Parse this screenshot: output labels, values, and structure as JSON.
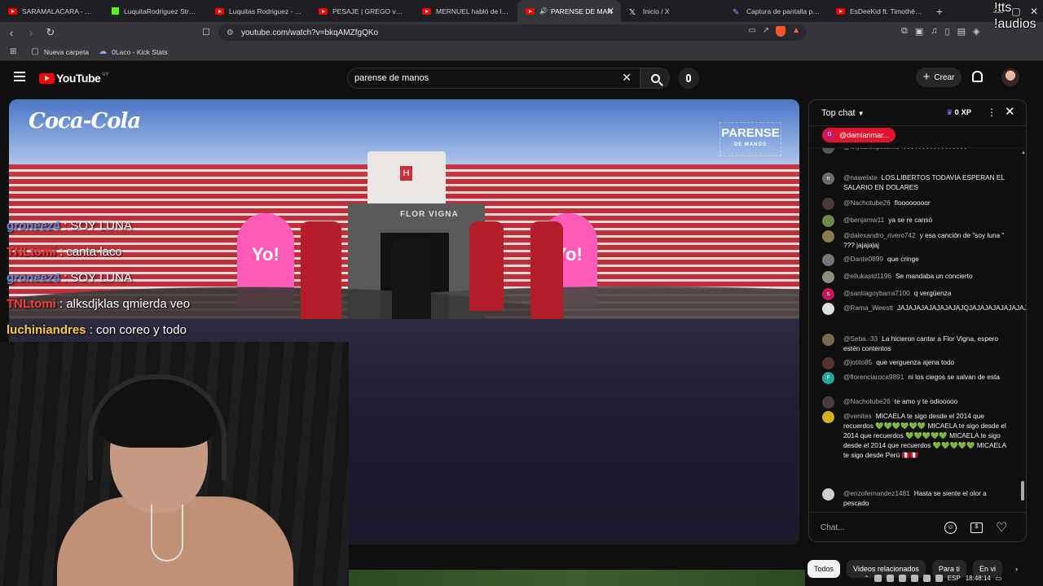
{
  "browser": {
    "tabs": [
      {
        "label": "SARAMALACARA - CREO C",
        "icon": "youtube-icon",
        "active": false
      },
      {
        "label": "LuquitaRodriguez Stream",
        "icon": "kick-icon",
        "active": false
      },
      {
        "label": "Luquitas Rodriguez - YouT",
        "icon": "youtube-icon",
        "active": false
      },
      {
        "label": "PESAJE | GREGO vs. GONC",
        "icon": "youtube-icon",
        "active": false
      },
      {
        "label": "MERNUEL habló de la POL",
        "icon": "youtube-icon",
        "active": false
      },
      {
        "label": "PARENSE DE MAN",
        "icon": "youtube-icon",
        "active": true
      },
      {
        "label": "Inicio / X",
        "icon": "x-icon",
        "active": false
      },
      {
        "label": "Captura de pantalla por Li",
        "icon": "pen-icon",
        "active": false
      },
      {
        "label": "EsDeeKid ft. Timothée Cha",
        "icon": "youtube-icon",
        "active": false
      }
    ],
    "url": "youtube.com/watch?v=bkqAMZfgQKo",
    "bookmarks": [
      {
        "label": "Nueva carpeta",
        "icon": "folder-icon"
      },
      {
        "label": "0Laco - Kick Stats",
        "icon": "link-icon"
      }
    ],
    "overlay_text": "!tts !audios"
  },
  "youtube": {
    "logo": "YouTube",
    "country": "UY",
    "search_query": "parense de manos",
    "create_label": "Crear"
  },
  "video": {
    "sponsor": "Coca-Cola",
    "brand_logo_top": "PARENSE",
    "brand_logo_bottom": "DE MANOS",
    "screen_text": "FLOR VIGNA",
    "banner_text": "Yo!"
  },
  "stream_chat": [
    {
      "user": "groneez4",
      "text": "SOY LUNA",
      "color": "#5b8fe0"
    },
    {
      "user": "TNLtomi",
      "text": "canta laco",
      "color": "#ff3b3b"
    },
    {
      "user": "groneez4",
      "text": "SOY LUNA",
      "color": "#5b8fe0"
    },
    {
      "user": "TNLtomi",
      "text": "alksdjklas qmierda veo",
      "color": "#ff3b3b"
    },
    {
      "user": "luchiniandres",
      "text": "con coreo y todo",
      "color": "#ffc83d"
    }
  ],
  "live_chat": {
    "mode": "Top chat",
    "xp": "0 XP",
    "pinned_user": "@damianmar...",
    "input_placeholder": "Chat...",
    "messages": [
      {
        "author": "@lviysuloopeterno",
        "text": "?????????????????",
        "avatar_color": "#555",
        "initial": ""
      },
      {
        "author": "@nawelate",
        "text": "LOS.LIBERTOS TODAVIA ESPERAN EL SALARIO EN DOLARES",
        "avatar_color": "#6b6b6b",
        "initial": "n"
      },
      {
        "author": "@Nachotube26",
        "text": "floooooooor",
        "avatar_color": "#4a3b3b",
        "initial": ""
      },
      {
        "author": "@benjamw11",
        "text": "ya se re cansó",
        "avatar_color": "#6d8a4d",
        "initial": ""
      },
      {
        "author": "@dalexandro_rivero742",
        "text": "y esa canción de \"soy luna \" ??? jajajajaj",
        "avatar_color": "#8a7a4d",
        "initial": ""
      },
      {
        "author": "@Dante0899",
        "text": "que cringe",
        "avatar_color": "#777",
        "initial": ""
      },
      {
        "author": "@ellukastd1196",
        "text": "Se mandaba un concierto",
        "avatar_color": "#8c8c7a",
        "initial": ""
      },
      {
        "author": "@santiagoybarra7100",
        "text": "q vergüenza",
        "avatar_color": "#c2185b",
        "initial": "s"
      },
      {
        "author": "@Rama_Weestt",
        "text": "JAJAJAJAJAJAJAJAJQJAJAJAJAJAJAJAJAJAJAJA",
        "avatar_color": "#e0e0e0",
        "initial": ""
      },
      {
        "author": "@Seba.-33",
        "text": "La hicieron cantar a Flor Vigna, espero estén contentos",
        "avatar_color": "#7a6a4d",
        "initial": ""
      },
      {
        "author": "@jotito85",
        "text": "que verguenza ajena todo",
        "avatar_color": "#5a3030",
        "initial": ""
      },
      {
        "author": "@florenciaroca9891",
        "text": "ni los ciegos se salvan de esta",
        "avatar_color": "#26a69a",
        "initial": "F"
      },
      {
        "author": "@Nachotube26",
        "text": "te amo y te odiooooo",
        "avatar_color": "#4a3b3b",
        "initial": ""
      },
      {
        "author": "@venites",
        "text": "MICAELA te sigo desde el 2014 que recuerdos 💚💚💚💚💚💚 MICAELA te sigo desde el 2014 que recuerdos 💚💚💚💚💚 MICAELA te sigo desde el 2014 que recuerdos 💚💚💚💚💚 MICAELA te sigo desde Perú 🇵🇪🇵🇪",
        "avatar_color": "#d4b01e",
        "initial": ""
      },
      {
        "author": "@enzofernandez1481",
        "text": "Hasta se siente el olor a pescado",
        "avatar_color": "#cfcfcf",
        "initial": ""
      }
    ]
  },
  "chips": [
    {
      "label": "Todos",
      "active": true
    },
    {
      "label": "Videos relacionados",
      "active": false
    },
    {
      "label": "Para ti",
      "active": false
    },
    {
      "label": "En vi",
      "active": false
    }
  ],
  "taskbar": {
    "language": "ESP",
    "time": "18:48:14"
  }
}
